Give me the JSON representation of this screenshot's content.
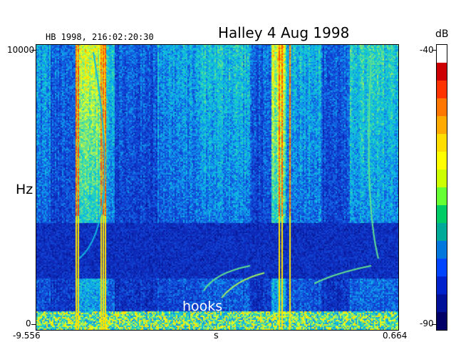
{
  "chart_data": {
    "type": "heatmap",
    "title": "Halley  4 Aug 1998",
    "timestamp": "HB 1998, 216:02:20:30",
    "xlabel": "s",
    "ylabel": "Hz",
    "xlim": [
      -9.556,
      0.664
    ],
    "ylim": [
      0,
      10000
    ],
    "x_tick_labels": [
      "-9.556",
      "0.664"
    ],
    "y_tick_labels": [
      "0",
      "10000"
    ],
    "colorbar": {
      "unit": "dB",
      "range": [
        -90,
        -40
      ],
      "max_label": "-40",
      "min_label": "-90",
      "colors": [
        "#ffffff",
        "#cc0000",
        "#ff3300",
        "#ff7700",
        "#ffaa00",
        "#ffdd00",
        "#ffff00",
        "#ccff00",
        "#66ff33",
        "#00cc66",
        "#00aa99",
        "#0077dd",
        "#0044ff",
        "#0022cc",
        "#001199",
        "#000066"
      ]
    },
    "annotations": [
      {
        "text": "hooks"
      }
    ],
    "colors": {
      "background_low": "#0a1a9a",
      "intense": "#ff3300",
      "mid": "#ffff00",
      "spectrogram_cyan": "#00ccdd"
    }
  }
}
